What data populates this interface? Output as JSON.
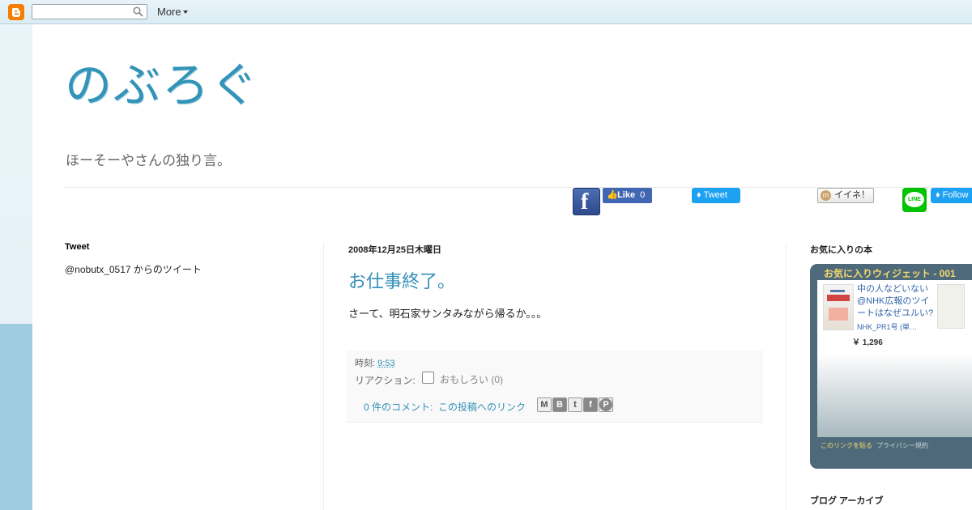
{
  "navbar": {
    "search_placeholder": "",
    "more_label": "More"
  },
  "header": {
    "title": "のぶろぐ",
    "description": "ほーそーやさんの独り言。"
  },
  "social": {
    "fb_like_label": "Like",
    "fb_like_count": "0",
    "tweet_label": "Tweet",
    "mixi_label": "イイネ！",
    "line_label": "LINE",
    "follow_label": "Follow"
  },
  "left_sidebar": {
    "heading": "Tweet",
    "tweets_link": "@nobutx_0517 からのツイート"
  },
  "post": {
    "date": "2008年12月25日木曜日",
    "title": "お仕事終了。",
    "body": "さーて、明石家サンタみながら帰るか。。。",
    "time_label": "時刻:",
    "time": "9:53",
    "reaction_label": "リアクション:",
    "reaction_option": "おもしろい (0)",
    "comments_link": "0 件のコメント:",
    "permalink": "この投稿へのリンク",
    "share_icons": [
      "email-icon",
      "blogger-icon",
      "twitter-icon",
      "facebook-icon",
      "pinterest-icon"
    ]
  },
  "right_sidebar": {
    "fav_heading": "お気に入りの本",
    "widget_title": "お気に入りウィジェット - 001",
    "book_title": "中の人などいない @NHK広報のツイートはなぜユルい?",
    "book_author": "NHK_PR1号 (単…",
    "book_price": "￥ 1,296",
    "widget_link": "このリンクを貼る",
    "widget_privacy": "プライバシー規約",
    "archive_heading": "ブログ アーカイブ"
  },
  "colors": {
    "accent": "#3394b8",
    "widget_bg": "#4e6a7a",
    "widget_title": "#f3d76f"
  }
}
